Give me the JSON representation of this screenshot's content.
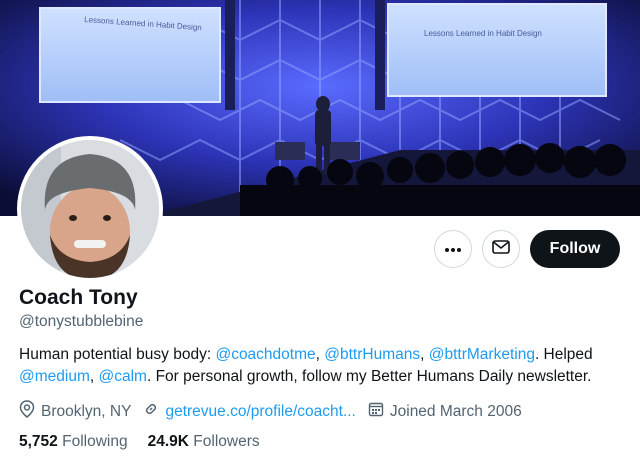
{
  "banner": {
    "slide_left": "Lessons Learned in Habit Design",
    "slide_right": "Lessons Learned in Habit Design"
  },
  "profile": {
    "name": "Coach Tony",
    "handle": "@tonystubblebine"
  },
  "actions": {
    "more_icon": "more-dots-icon",
    "message_icon": "envelope-icon",
    "follow_label": "Follow"
  },
  "bio": {
    "text1": "Human potential busy body: ",
    "mention1": "@coachdotme",
    "sep1": ",  ",
    "mention2": "@bttrHumans",
    "sep2": ", ",
    "mention3": "@bttrMarketing",
    "text2": ". Helped ",
    "mention4": "@medium",
    "sep3": ", ",
    "mention5": "@calm",
    "text3": ". For personal growth, follow my Better Humans Daily newsletter."
  },
  "meta": {
    "location": "Brooklyn, NY",
    "link": "getrevue.co/profile/coacht...",
    "joined": "Joined March 2006"
  },
  "stats": {
    "following_count": "5,752",
    "following_label": "Following",
    "followers_count": "24.9K",
    "followers_label": "Followers"
  },
  "colors": {
    "accent": "#1d9bf0",
    "text": "#0f1419",
    "secondary": "#536471",
    "button": "#0f1419"
  }
}
